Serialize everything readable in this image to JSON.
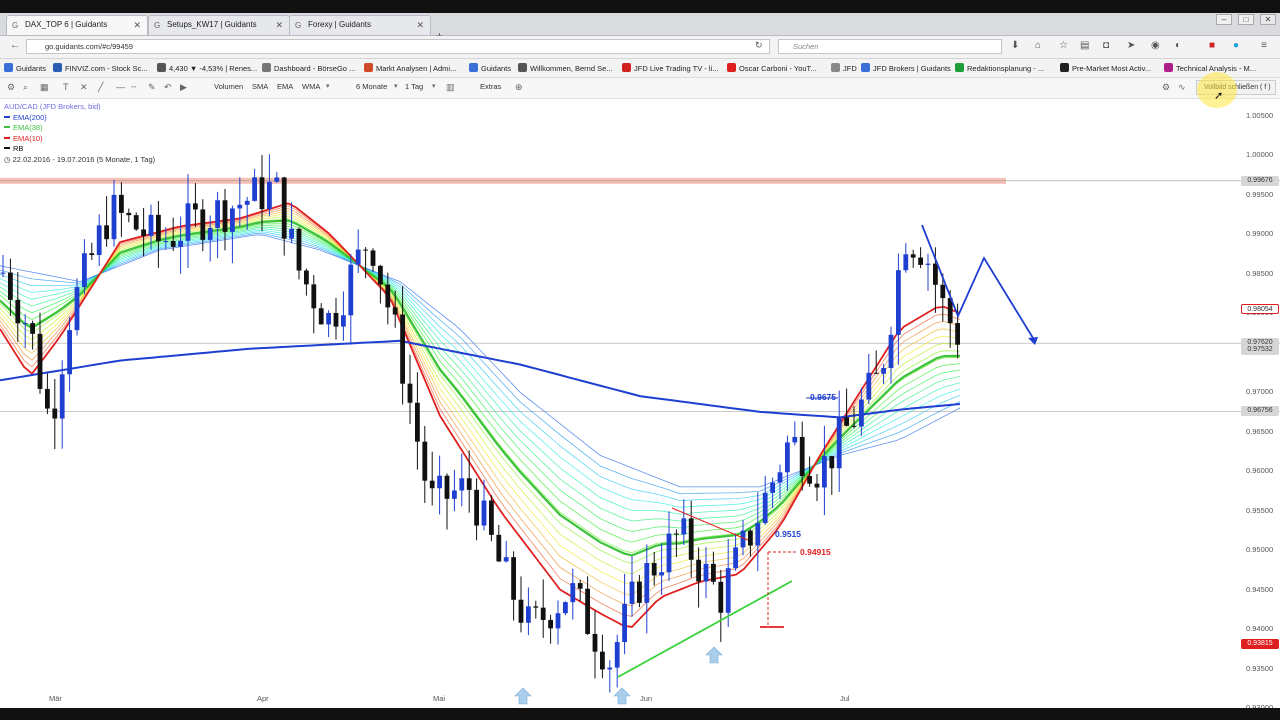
{
  "browser": {
    "tabs": [
      {
        "label": "DAX_TOP 6 | Guidants",
        "active": true
      },
      {
        "label": "Setups_KW17 | Guidants",
        "active": false
      },
      {
        "label": "Forexy | Guidants",
        "active": false
      }
    ],
    "new_tab_label": "+",
    "url": "go.guidants.com/#c/99459",
    "search_placeholder": "Suchen",
    "bookmarks": [
      {
        "label": "Guidants",
        "color": "#3a6fd8"
      },
      {
        "label": "FINVIZ.com - Stock Sc...",
        "color": "#2c5db5"
      },
      {
        "label": "4,430 ▼ -4,53% | Renes...",
        "color": "#555555"
      },
      {
        "label": "Dashboard - BörseGo ...",
        "color": "#777777"
      },
      {
        "label": "Markt Analysen | Admi...",
        "color": "#d04a2a"
      },
      {
        "label": "Guidants",
        "color": "#3a6fd8"
      },
      {
        "label": "Willkommen, Bernd Se...",
        "color": "#555555"
      },
      {
        "label": "JFD Live Trading TV - li...",
        "color": "#d02020"
      },
      {
        "label": "Oscar Carboni - YouT...",
        "color": "#e02020"
      },
      {
        "label": "JFD",
        "color": "#888888"
      },
      {
        "label": "JFD Brokers | Guidants",
        "color": "#3a6fd8"
      },
      {
        "label": "Redaktionsplanung - ...",
        "color": "#1e9e3a"
      },
      {
        "label": "Pre-Market Most Activ...",
        "color": "#222222"
      },
      {
        "label": "Technical Analysis - M...",
        "color": "#b0208a"
      }
    ]
  },
  "toolbar": {
    "volumen": "Volumen",
    "sma": "SMA",
    "ema": "EMA",
    "wma": "WMA",
    "period": "6 Monate",
    "interval": "1 Tag",
    "extras": "Extras",
    "fullscreen": "Vollbild schließen ( f )"
  },
  "chart_data": {
    "type": "candlestick",
    "instrument": "AUD/CAD (JFD Brokers, bid)",
    "range_label": "22.02.2016 - 19.07.2016 (5 Monate, 1 Tag)",
    "legend": [
      {
        "name": "EMA(200)",
        "color": "#1f3fd1"
      },
      {
        "name": "EMA(38)",
        "color": "#3cc23c"
      },
      {
        "name": "EMA(10)",
        "color": "#e02020"
      },
      {
        "name": "RB",
        "color": "#111111"
      }
    ],
    "x_ticks": [
      "Mär",
      "Apr",
      "Mai",
      "Jun",
      "Jul"
    ],
    "y_ticks": [
      "1.00500",
      "1.00000",
      "0.99500",
      "0.99000",
      "0.98500",
      "0.98000",
      "0.97500",
      "0.97000",
      "0.96500",
      "0.96000",
      "0.95500",
      "0.95000",
      "0.94500",
      "0.94000",
      "0.93500",
      "0.93000"
    ],
    "ylim": [
      0.93,
      1.007
    ],
    "price_tags": [
      {
        "value": "0.99676",
        "style": "gray"
      },
      {
        "value": "0.98054",
        "style": "outline-red"
      },
      {
        "value": "0.97620",
        "style": "gray"
      },
      {
        "value": "0.97532",
        "style": "gray"
      },
      {
        "value": "0.96756",
        "style": "gray"
      },
      {
        "value": "0.93815",
        "style": "red"
      }
    ],
    "annotations": [
      {
        "text": "0.9675",
        "color": "#1f3fd1"
      },
      {
        "text": "0.9515",
        "color": "#1f3fd1"
      },
      {
        "text": "0.94915",
        "color": "#e02020"
      }
    ],
    "resistance_level": 0.99676,
    "grid": false
  }
}
